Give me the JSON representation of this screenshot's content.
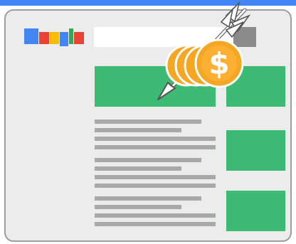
{
  "illustration": {
    "subject": "search-results-page-with-paid-ad-arrow-and-coins",
    "colors": {
      "top_bar": "#4285f4",
      "page_bg": "#ececec",
      "page_border": "#9e9e9e",
      "search_box": "#ffffff",
      "search_button": "#8a8a8a",
      "ad_block": "#3dba73",
      "text_line": "#a8a8a8",
      "coin": "#f5a623",
      "coin_inner": "#fbb034",
      "arrow": "#ffffff",
      "logo_blue": "#4285f4",
      "logo_red": "#ea4335",
      "logo_yellow": "#fbbc05",
      "logo_green": "#34a853"
    },
    "coin": {
      "symbol": "$",
      "count": 4
    },
    "icons": [
      "search-engine-logo-icon",
      "arrow-icon",
      "dollar-coin-icon"
    ]
  }
}
